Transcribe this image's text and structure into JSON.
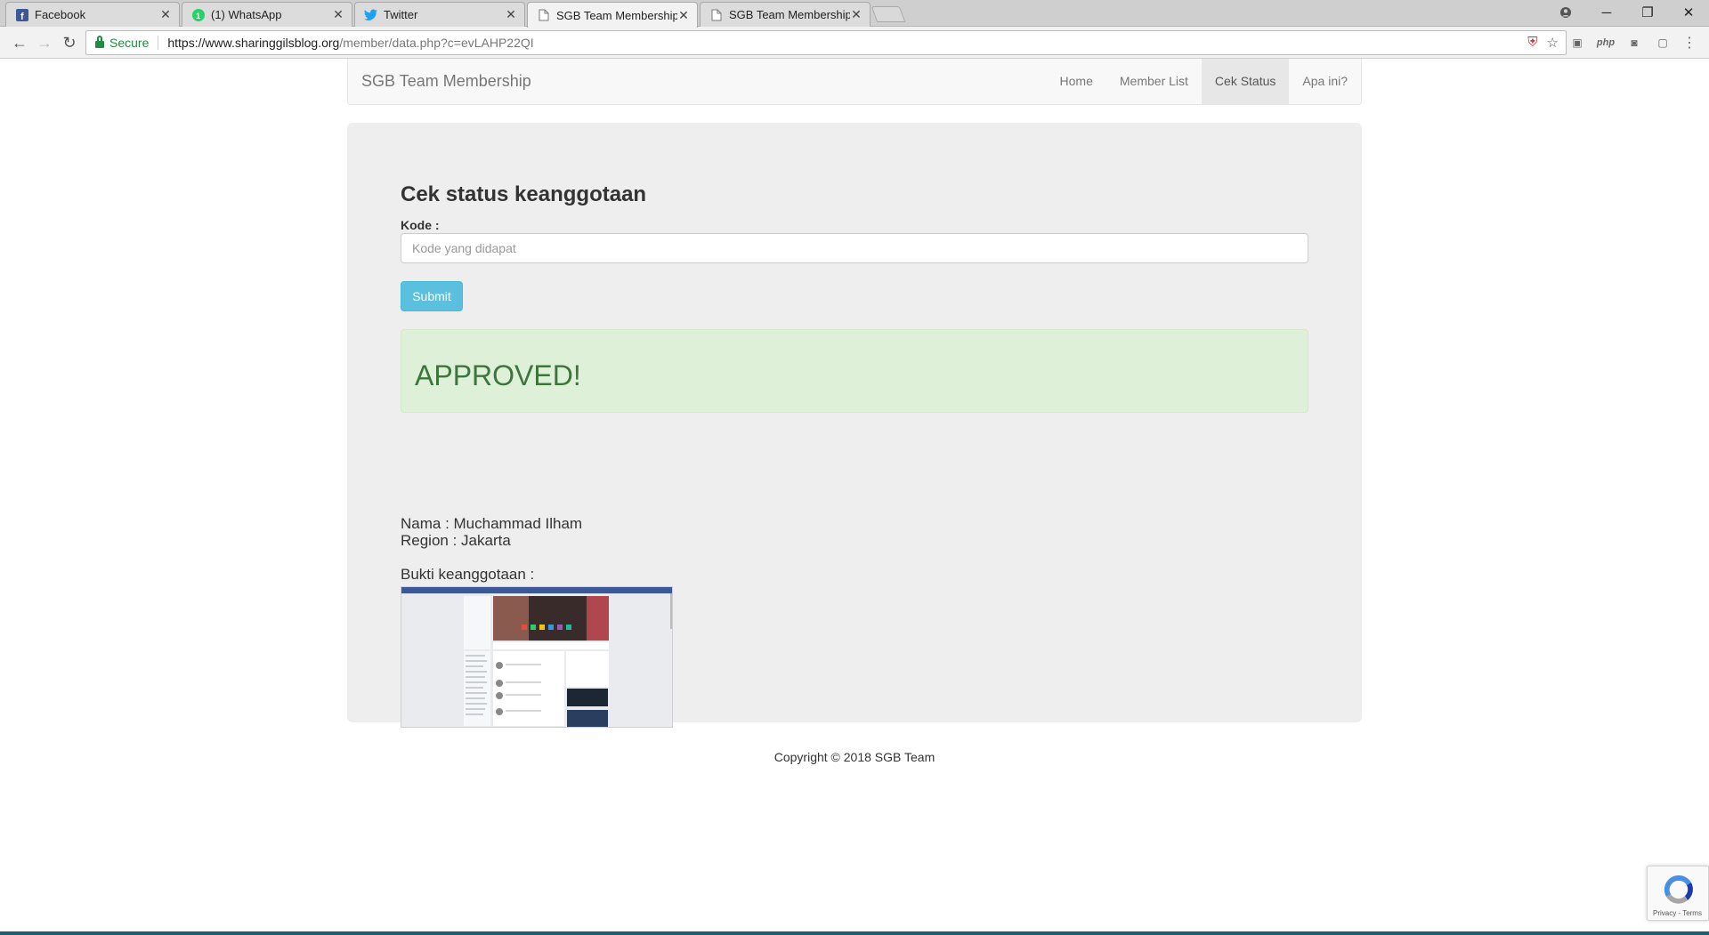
{
  "browser": {
    "tabs": [
      {
        "title": "Facebook",
        "icon": "facebook-icon"
      },
      {
        "title": "(1) WhatsApp",
        "icon": "whatsapp-icon"
      },
      {
        "title": "Twitter",
        "icon": "twitter-icon"
      },
      {
        "title": "SGB Team Membership -",
        "icon": "page-icon",
        "active": true
      },
      {
        "title": "SGB Team Membership -",
        "icon": "page-icon"
      }
    ],
    "secure_label": "Secure",
    "url_host": "https://www.sharinggilsblog.org",
    "url_path": "/member/data.php?c=evLAHP22QI",
    "ext_php_label": "php"
  },
  "navbar": {
    "brand": "SGB Team Membership",
    "links": [
      {
        "label": "Home"
      },
      {
        "label": "Member List"
      },
      {
        "label": "Cek Status",
        "active": true
      },
      {
        "label": "Apa ini?"
      }
    ]
  },
  "form": {
    "heading": "Cek status keanggotaan",
    "kode_label": "Kode :",
    "kode_placeholder": "Kode yang didapat",
    "submit_label": "Submit"
  },
  "result": {
    "status": "APPROVED!",
    "nama": "Nama : Muchammad Ilham",
    "region": "Region : Jakarta",
    "bukti_label": "Bukti keanggotaan :"
  },
  "footer": {
    "copyright": "Copyright © 2018 SGB Team"
  },
  "recaptcha": {
    "links": "Privacy - Terms"
  },
  "colors": {
    "accent": "#5bc0de",
    "success_bg": "#dff0d8",
    "success_text": "#3c763d",
    "secure_green": "#1e8e3e"
  }
}
